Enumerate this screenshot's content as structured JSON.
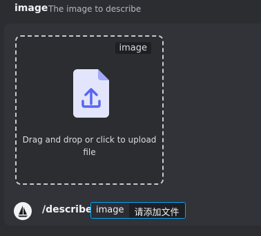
{
  "header": {
    "param_name": "image",
    "param_description": "The image to describe"
  },
  "dropzone": {
    "tag": "image",
    "text": "Drag and drop or click to upload file",
    "icon": "upload-file-icon"
  },
  "command": {
    "name": "/describe",
    "option_name": "image",
    "option_placeholder": "请添加文件",
    "bot_icon": "sailboat-avatar-icon"
  },
  "colors": {
    "background": "#2b2d31",
    "panel": "#313338",
    "accent": "#5865f2",
    "focus": "#00a8fc"
  }
}
